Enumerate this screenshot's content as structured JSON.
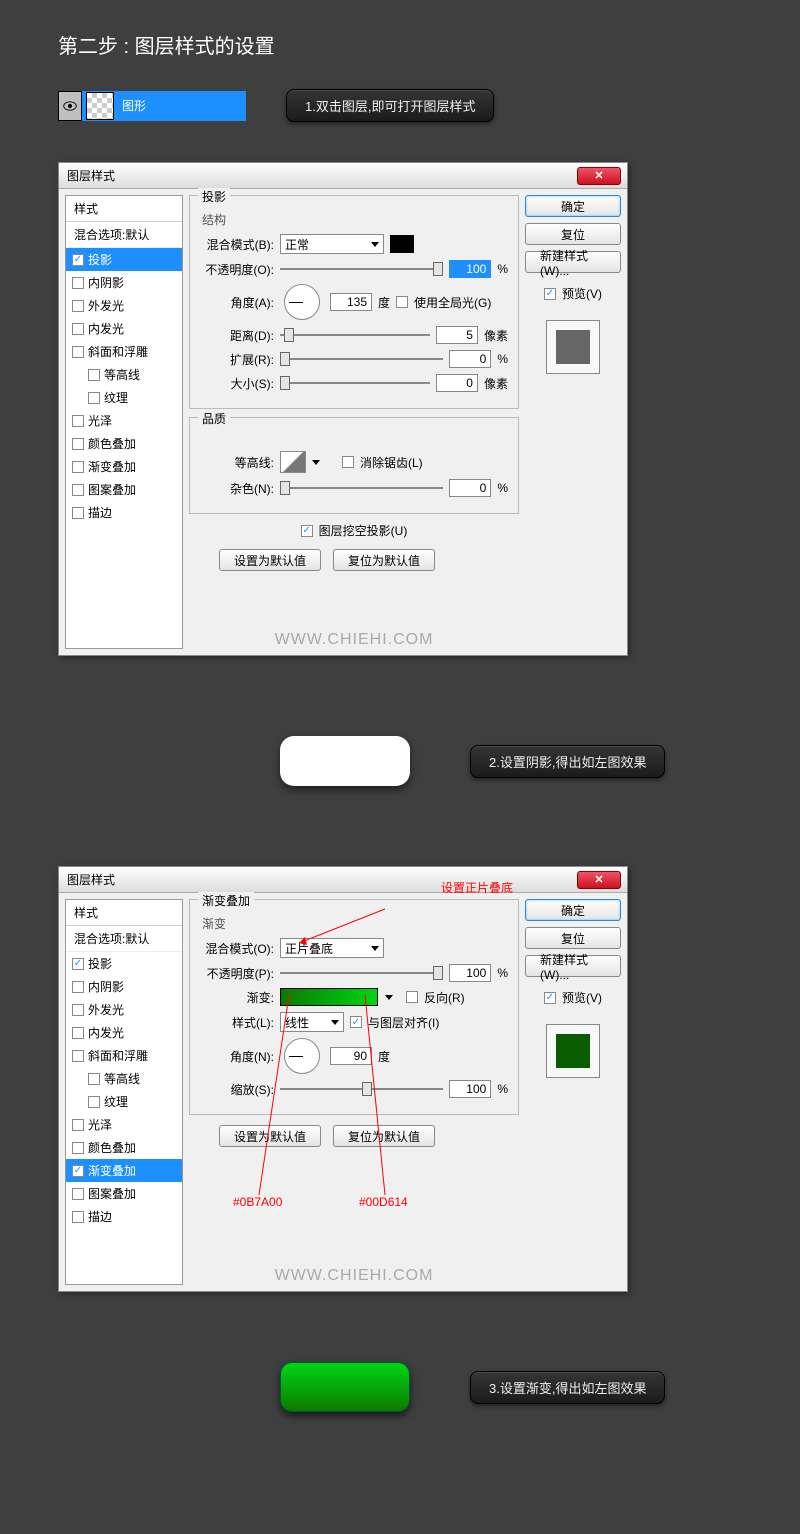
{
  "step_title": "第二步 : 图层样式的设置",
  "layer": {
    "name": "图形"
  },
  "tips": {
    "t1": "1.双击图层,即可打开图层样式",
    "t2": "2.设置阴影,得出如左图效果",
    "t3": "3.设置渐变,得出如左图效果"
  },
  "dialog": {
    "title": "图层样式",
    "styles_header": "样式",
    "blending_default": "混合选项:默认",
    "style_items": [
      {
        "label": "投影",
        "checked": true
      },
      {
        "label": "内阴影",
        "checked": false
      },
      {
        "label": "外发光",
        "checked": false
      },
      {
        "label": "内发光",
        "checked": false
      },
      {
        "label": "斜面和浮雕",
        "checked": false
      },
      {
        "label": "等高线",
        "checked": false,
        "indent": true
      },
      {
        "label": "纹理",
        "checked": false,
        "indent": true
      },
      {
        "label": "光泽",
        "checked": false
      },
      {
        "label": "颜色叠加",
        "checked": false
      },
      {
        "label": "渐变叠加",
        "checked": false
      },
      {
        "label": "图案叠加",
        "checked": false
      },
      {
        "label": "描边",
        "checked": false
      }
    ],
    "drop_shadow": {
      "group": "投影",
      "structure": "结构",
      "blend_mode_label": "混合模式(B):",
      "blend_mode_value": "正常",
      "opacity_label": "不透明度(O):",
      "opacity_value": "100",
      "opacity_unit": "%",
      "angle_label": "角度(A):",
      "angle_value": "135",
      "angle_unit": "度",
      "use_global_label": "使用全局光(G)",
      "distance_label": "距离(D):",
      "distance_value": "5",
      "distance_unit": "像素",
      "spread_label": "扩展(R):",
      "spread_value": "0",
      "spread_unit": "%",
      "size_label": "大小(S):",
      "size_value": "0",
      "size_unit": "像素",
      "quality": "品质",
      "contour_label": "等高线:",
      "anti_alias_label": "消除锯齿(L)",
      "noise_label": "杂色(N):",
      "noise_value": "0",
      "noise_unit": "%",
      "knockout_label": "图层挖空投影(U)",
      "set_default": "设置为默认值",
      "reset_default": "复位为默认值"
    },
    "gradient_overlay": {
      "group": "渐变叠加",
      "sub": "渐变",
      "blend_mode_label": "混合模式(O):",
      "blend_mode_value": "正片叠底",
      "opacity_label": "不透明度(P):",
      "opacity_value": "100",
      "opacity_unit": "%",
      "gradient_label": "渐变:",
      "reverse_label": "反向(R)",
      "style_label": "样式(L):",
      "style_value": "线性",
      "align_label": "与图层对齐(I)",
      "angle_label": "角度(N):",
      "angle_value": "90",
      "angle_unit": "度",
      "scale_label": "缩放(S):",
      "scale_value": "100",
      "scale_unit": "%",
      "set_default": "设置为默认值",
      "reset_default": "复位为默认值",
      "annot_title": "设置正片叠底",
      "annot_c1": "#0B7A00",
      "annot_c2": "#00D614"
    },
    "buttons": {
      "ok": "确定",
      "cancel": "复位",
      "new_style": "新建样式(W)...",
      "preview": "预览(V)"
    },
    "watermark": "WWW.CHIEHI.COM"
  }
}
